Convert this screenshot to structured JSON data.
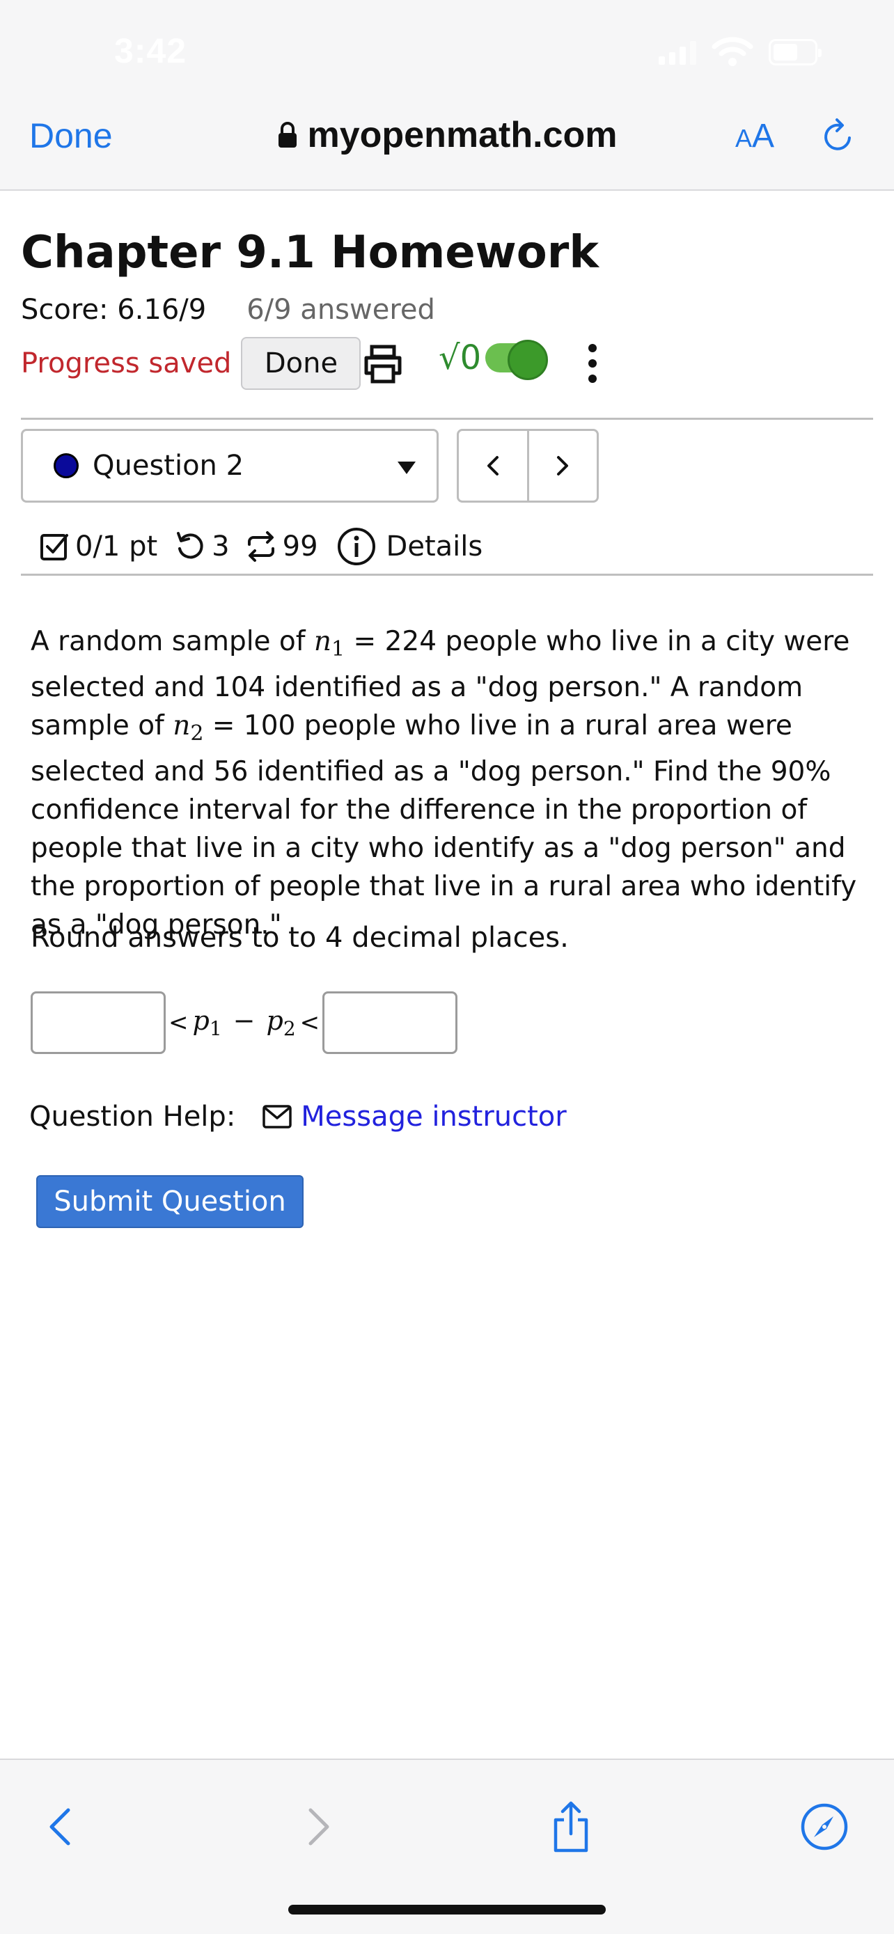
{
  "status_bar": {
    "time": "3:42"
  },
  "safari": {
    "done_label": "Done",
    "url": "myopenmath.com",
    "text_size_label_small": "A",
    "text_size_label_large": "A"
  },
  "page": {
    "title": "Chapter 9.1 Homework",
    "score": "Score: 6.16/9",
    "answered": "6/9 answered",
    "progress_saved": "Progress saved",
    "done_button": "Done",
    "math_toggle_symbol": "√0"
  },
  "question": {
    "selector_label": "Question 2",
    "points": "0/1 pt",
    "attempts": "3",
    "versions": "99",
    "details_label": "Details",
    "text_part1": "A random sample of ",
    "var_n1": "n",
    "sub_1": "1",
    "text_part2": " = 224 people who live in a city were selected and 104 identified as a \"dog person.\" A random sample of ",
    "var_n2": "n",
    "sub_2": "2",
    "text_part3": " = 100 people who live in a rural area were selected and 56 identified as a \"dog person.\" Find the 90% confidence interval for the difference in the proportion of people that live in a city who identify as a \"dog person\" and the proportion of people that live in a rural area who identify as a \"dog person.\"",
    "round_note": "Round answers to to 4 decimal places.",
    "lower_value": "",
    "upper_value": "",
    "lt_symbol": "<",
    "p_var": "p",
    "minus": "−",
    "help_label": "Question Help:",
    "message_link": "Message instructor",
    "submit_label": "Submit Question"
  },
  "colors": {
    "link_blue": "#1f76e8",
    "progress_red": "#c1272d",
    "submit_blue": "#3a78d4",
    "toggle_green": "#3c9a2a",
    "message_link": "#2222dd"
  },
  "icons": [
    "lock-icon",
    "reload-icon",
    "print-icon",
    "toggle-icon",
    "more-icon",
    "chevron-left-icon",
    "chevron-right-icon",
    "checkbox-icon",
    "retry-icon",
    "versions-icon",
    "info-icon",
    "mail-icon",
    "share-icon",
    "compass-icon"
  ]
}
